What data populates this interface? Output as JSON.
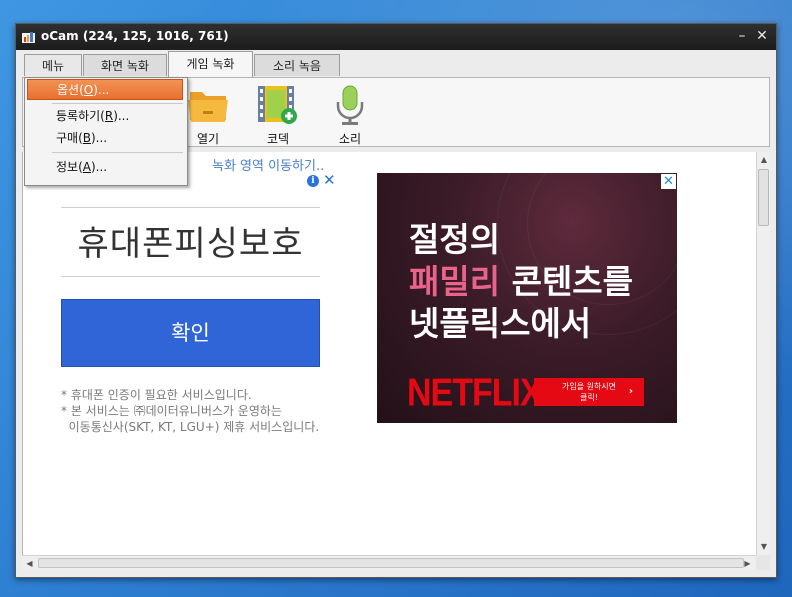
{
  "window": {
    "title": "oCam (224, 125, 1016, 761)",
    "minimize_glyph": "–",
    "close_glyph": "✕"
  },
  "tabs": [
    {
      "label": "메뉴"
    },
    {
      "label": "화면 녹화"
    },
    {
      "label": "게임 녹화"
    },
    {
      "label": "소리 녹음"
    }
  ],
  "active_tab": "게임 녹화",
  "toolbar": {
    "open_label": "열기",
    "codec_label": "코덱",
    "sound_label": "소리"
  },
  "menu": {
    "items": [
      {
        "label": "옵션(",
        "hotkey": "O",
        "suffix": ")...",
        "selected": true
      },
      {
        "label": "등록하기(",
        "hotkey": "R",
        "suffix": ")..."
      },
      {
        "label": "구매(",
        "hotkey": "B",
        "suffix": ")..."
      },
      {
        "label": "정보(",
        "hotkey": "A",
        "suffix": ")..."
      }
    ]
  },
  "content": {
    "moving_text": "녹화 영역 이동하기..",
    "ad_left": {
      "info_glyph": "i",
      "close_glyph": "✕",
      "title": "휴대폰피싱보호",
      "button_label": "확인",
      "notes": [
        "* 휴대폰 인증이 필요한 서비스입니다.",
        "* 본 서비스는 ㈜데이터유니버스가 운영하는",
        "  이동통신사(SKT, KT, LGU+) 제휴 서비스입니다."
      ]
    },
    "ad_right": {
      "line1": "절정의",
      "line2_pink": "패밀리",
      "line2_rest": " 콘텐츠를",
      "line3": "넷플릭스에서",
      "logo": "NETFLIX",
      "cta_line1": "가입을 원하시면",
      "cta_line2": "클릭!",
      "cta_chevron": "›",
      "adchoice_glyph": "✕"
    }
  },
  "colors": {
    "menu_selected": "#e9702f",
    "netflix_red": "#e50914",
    "link_blue": "#4a7fc4",
    "confirm_blue": "#2f65d6"
  }
}
